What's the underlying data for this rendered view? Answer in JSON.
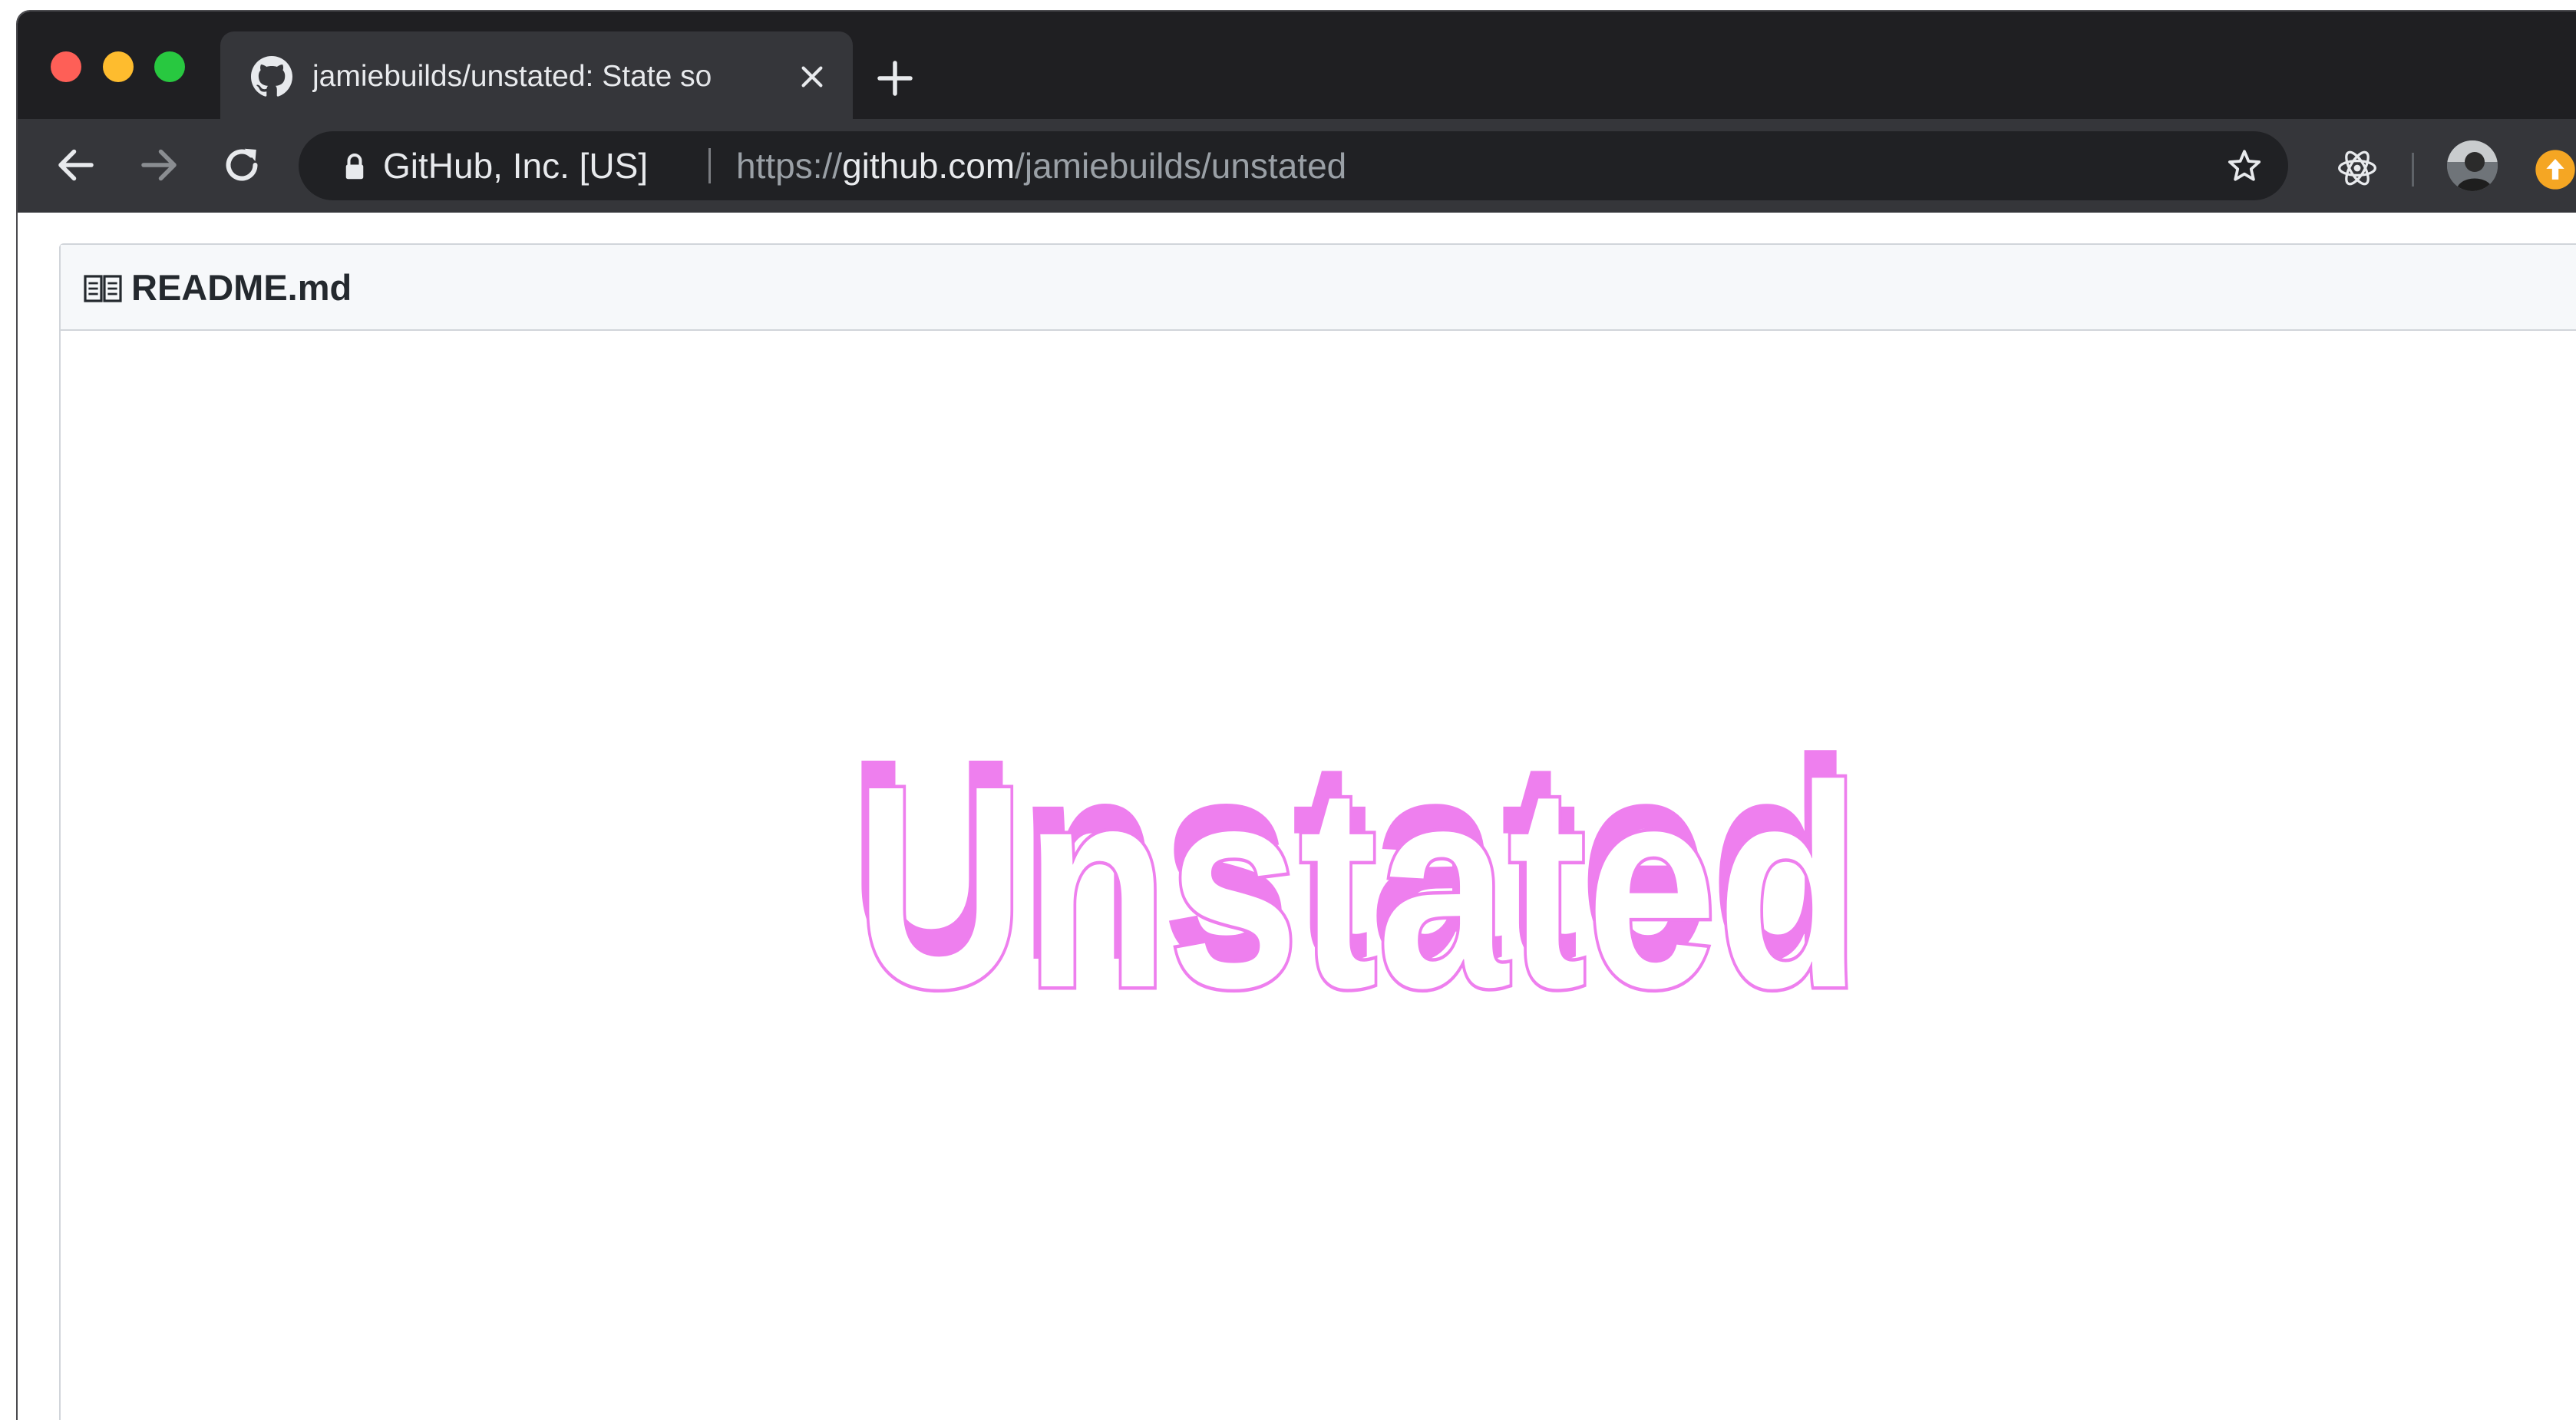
{
  "browser": {
    "tab": {
      "title": "jamiebuilds/unstated: State so",
      "favicon": "github-icon"
    },
    "omnibox": {
      "site_owner": "GitHub, Inc. [US]",
      "url_scheme": "https://",
      "url_host": "github.com",
      "url_path": "/jamiebuilds/unstated"
    },
    "icons": {
      "back": "arrow-left-icon",
      "forward": "arrow-right-icon",
      "reload": "reload-icon",
      "lock": "lock-icon",
      "star": "star-icon",
      "react_extension": "react-devtools-icon",
      "update": "update-arrow-icon"
    },
    "colors": {
      "titlebar": "#1f1f22",
      "toolbar": "#35363a",
      "omnibox": "#202124",
      "update_badge": "#f5a623"
    }
  },
  "readme": {
    "filename": "README.md",
    "logo": {
      "text": "Unstated",
      "color": "#ee7fee"
    }
  }
}
